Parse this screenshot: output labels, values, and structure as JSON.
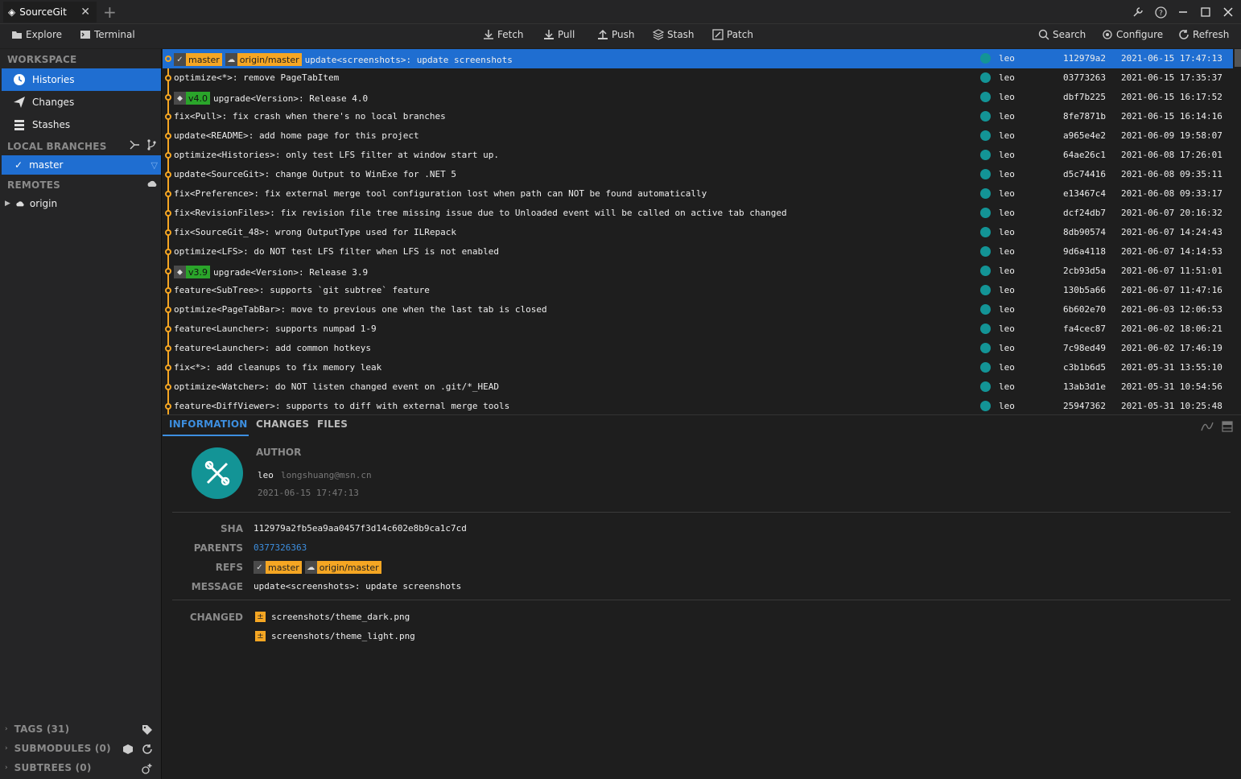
{
  "app": {
    "tab_title": "SourceGit",
    "close": "✕",
    "new_tab": "+"
  },
  "toolbar": {
    "explore": "Explore",
    "terminal": "Terminal",
    "fetch": "Fetch",
    "pull": "Pull",
    "push": "Push",
    "stash": "Stash",
    "patch": "Patch",
    "search": "Search",
    "configure": "Configure",
    "refresh": "Refresh"
  },
  "sidebar": {
    "workspace_title": "WORKSPACE",
    "workspace_items": [
      {
        "label": "Histories",
        "icon": "clock-icon"
      },
      {
        "label": "Changes",
        "icon": "send-icon"
      },
      {
        "label": "Stashes",
        "icon": "stack-icon"
      }
    ],
    "local_branches_title": "LOCAL BRANCHES",
    "branch": "master",
    "remotes_title": "REMOTES",
    "remote": "origin",
    "tags": "TAGS (31)",
    "submodules": "SUBMODULES (0)",
    "subtrees": "SUBTREES (0)"
  },
  "commits": [
    {
      "refs": [
        "master",
        "origin/master"
      ],
      "message": "update<screenshots>: update screenshots",
      "author": "leo",
      "sha": "112979a2",
      "time": "2021-06-15 17:47:13"
    },
    {
      "message": "optimize<*>: remove PageTabItem",
      "author": "leo",
      "sha": "03773263",
      "time": "2021-06-15 17:35:37"
    },
    {
      "tag": "v4.0",
      "message": "upgrade<Version>: Release 4.0",
      "author": "leo",
      "sha": "dbf7b225",
      "time": "2021-06-15 16:17:52"
    },
    {
      "message": "fix<Pull>: fix crash when there's no local branches",
      "author": "leo",
      "sha": "8fe7871b",
      "time": "2021-06-15 16:14:16"
    },
    {
      "message": "update<README>: add home page for this project",
      "author": "leo",
      "sha": "a965e4e2",
      "time": "2021-06-09 19:58:07"
    },
    {
      "message": "optimize<Histories>: only test LFS filter at window start up.",
      "author": "leo",
      "sha": "64ae26c1",
      "time": "2021-06-08 17:26:01"
    },
    {
      "message": "update<SourceGit>: change Output to WinExe for .NET 5",
      "author": "leo",
      "sha": "d5c74416",
      "time": "2021-06-08 09:35:11"
    },
    {
      "message": "fix<Preference>: fix external merge tool configuration lost when path can NOT be found automatically",
      "author": "leo",
      "sha": "e13467c4",
      "time": "2021-06-08 09:33:17"
    },
    {
      "message": "fix<RevisionFiles>: fix revision file tree missing issue due to Unloaded event will be called on active tab changed",
      "author": "leo",
      "sha": "dcf24db7",
      "time": "2021-06-07 20:16:32"
    },
    {
      "message": "fix<SourceGit_48>: wrong OutputType used for ILRepack",
      "author": "leo",
      "sha": "8db90574",
      "time": "2021-06-07 14:24:43"
    },
    {
      "message": "optimize<LFS>: do NOT test LFS filter when LFS is not enabled",
      "author": "leo",
      "sha": "9d6a4118",
      "time": "2021-06-07 14:14:53"
    },
    {
      "tag": "v3.9",
      "message": "upgrade<Version>: Release 3.9",
      "author": "leo",
      "sha": "2cb93d5a",
      "time": "2021-06-07 11:51:01"
    },
    {
      "message": "feature<SubTree>: supports `git subtree` feature",
      "author": "leo",
      "sha": "130b5a66",
      "time": "2021-06-07 11:47:16"
    },
    {
      "message": "optimize<PageTabBar>: move to previous one when the last tab is closed",
      "author": "leo",
      "sha": "6b602e70",
      "time": "2021-06-03 12:06:53"
    },
    {
      "message": "feature<Launcher>: supports numpad 1-9",
      "author": "leo",
      "sha": "fa4cec87",
      "time": "2021-06-02 18:06:21"
    },
    {
      "message": "feature<Launcher>: add common hotkeys",
      "author": "leo",
      "sha": "7c98ed49",
      "time": "2021-06-02 17:46:19"
    },
    {
      "message": "fix<*>: add cleanups to fix memory leak",
      "author": "leo",
      "sha": "c3b1b6d5",
      "time": "2021-05-31 13:55:10"
    },
    {
      "message": "optimize<Watcher>: do NOT listen changed event on .git/*_HEAD",
      "author": "leo",
      "sha": "13ab3d1e",
      "time": "2021-05-31 10:54:56"
    },
    {
      "message": "feature<DiffViewer>: supports to diff with external merge tools",
      "author": "leo",
      "sha": "25947362",
      "time": "2021-05-31 10:25:48"
    }
  ],
  "detail": {
    "tabs": [
      "INFORMATION",
      "CHANGES",
      "FILES"
    ],
    "author_label": "AUTHOR",
    "author_name": "leo",
    "author_email": "longshuang@msn.cn",
    "author_time": "2021-06-15 17:47:13",
    "sha_label": "SHA",
    "sha": "112979a2fb5ea9aa0457f3d14c602e8b9ca1c7cd",
    "parents_label": "PARENTS",
    "parents": "0377326363",
    "refs_label": "REFS",
    "refs": [
      "master",
      "origin/master"
    ],
    "message_label": "MESSAGE",
    "message": "update<screenshots>: update screenshots",
    "changed_label": "CHANGED",
    "changed_files": [
      "screenshots/theme_dark.png",
      "screenshots/theme_light.png"
    ]
  },
  "colors": {
    "accent": "#1f6ed1",
    "graph": "#f5a623",
    "tag": "#2aa52a",
    "avatar": "#139496"
  }
}
